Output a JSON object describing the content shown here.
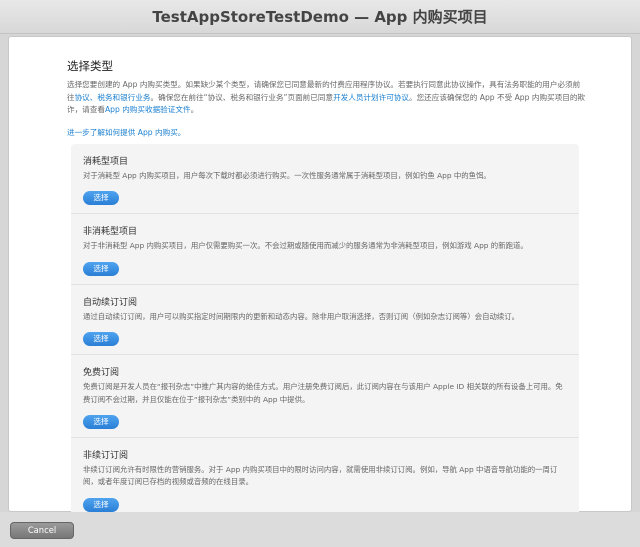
{
  "window": {
    "title": "TestAppStoreTestDemo — App 内购买项目"
  },
  "main": {
    "section_title": "选择类型",
    "intro_text_1": "选择您要创建的 App 内购买类型。如果缺少某个类型，请确保您已同意最新的付费应用程序协议。若要执行同意此协议操作，具有法务职能的用户必须前往",
    "intro_link_1": "协议、税务和银行业务",
    "intro_text_2": "。确保您在前往“协议、税务和银行业务”页面前已同意",
    "intro_link_2": "开发人员计划许可协议",
    "intro_text_3": "。您还应该确保您的 App 不受 App 内购买项目的欺诈，请查看",
    "intro_link_3": "App 内购买收据验证文件",
    "intro_text_4": "。",
    "learn_more_link": "进一步了解如何提供 App 内购买。"
  },
  "types": [
    {
      "name": "消耗型项目",
      "description": "对于消耗型 App 内购买项目，用户每次下载时都必须进行购买。一次性服务通常属于消耗型项目，例如钓鱼 App 中的鱼饵。",
      "button": "选择"
    },
    {
      "name": "非消耗型项目",
      "description": "对于非消耗型 App 内购买项目，用户仅需要购买一次。不会过期或随使用而减少的服务通常为非消耗型项目，例如游戏 App 的新跑道。",
      "button": "选择"
    },
    {
      "name": "自动续订订阅",
      "description": "通过自动续订订阅，用户可以购买指定时间期限内的更新和动态内容。除非用户取消选择，否则订阅（例如杂志订阅等）会自动续订。",
      "button": "选择"
    },
    {
      "name": "免费订阅",
      "description": "免费订阅是开发人员在“报刊杂志”中推广其内容的绝佳方式。用户注册免费订阅后，此订阅内容在与该用户 Apple ID 相关联的所有设备上可用。免费订阅不会过期，并且仅能在位于“报刊杂志”类别中的 App 中提供。",
      "button": "选择"
    },
    {
      "name": "非续订订阅",
      "description": "非续订订阅允许有时限性的营销服务。对于 App 内购买项目中的限时访问内容，就需使用非续订订阅。例如，导航 App 中语音导航功能的一周订阅，或者年度订阅已存档的视频或音频的在线目录。",
      "button": "选择"
    }
  ],
  "footer": {
    "cancel_label": "Cancel"
  }
}
